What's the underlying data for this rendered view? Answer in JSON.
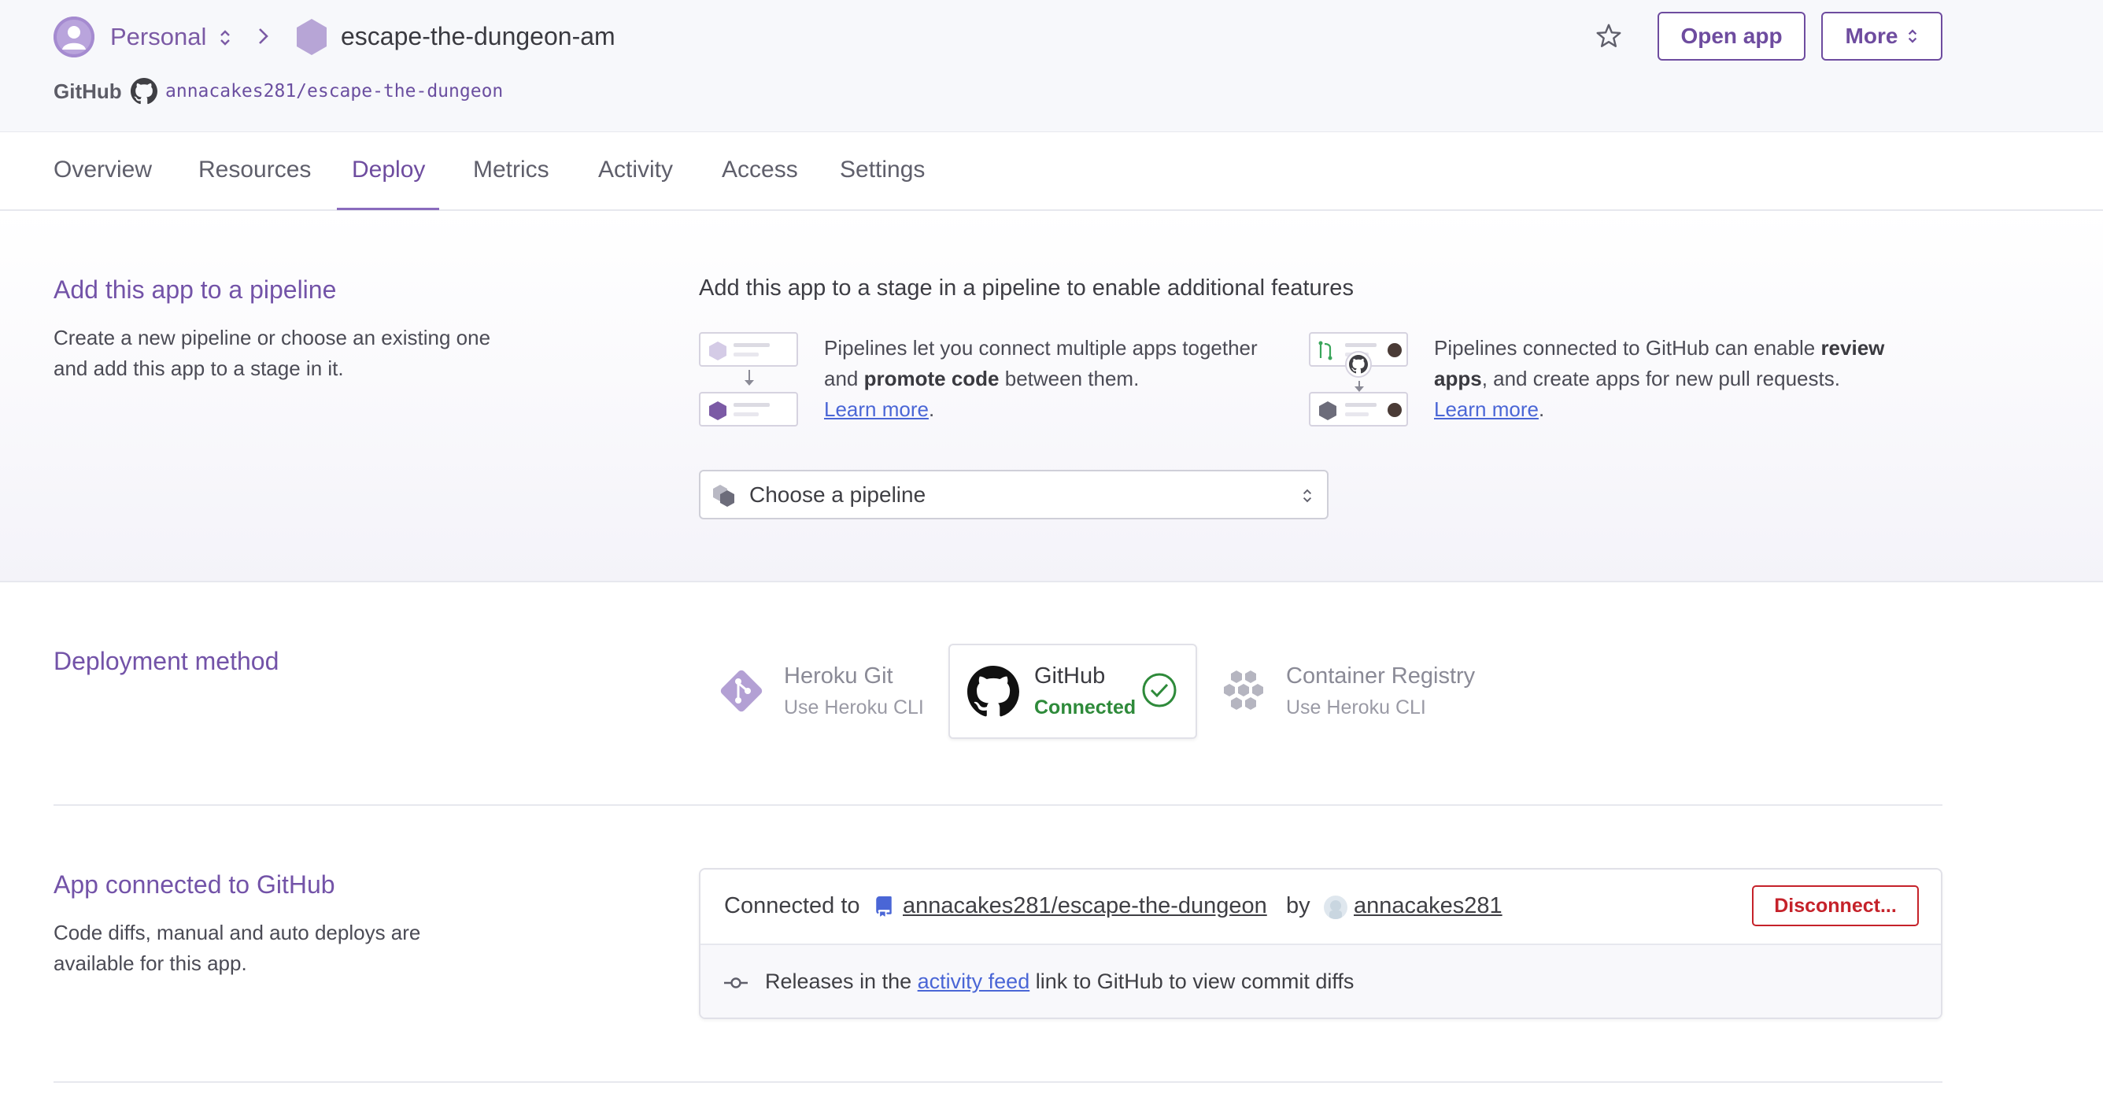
{
  "header": {
    "team": "Personal",
    "app_name": "escape-the-dungeon-am",
    "github_label": "GitHub",
    "repo_path": "annacakes281/escape-the-dungeon",
    "open_app": "Open app",
    "more": "More"
  },
  "tabs": [
    "Overview",
    "Resources",
    "Deploy",
    "Metrics",
    "Activity",
    "Access",
    "Settings"
  ],
  "active_tab": "Deploy",
  "pipeline": {
    "title": "Add this app to a pipeline",
    "description": "Create a new pipeline or choose an existing one and add this app to a stage in it.",
    "lead": "Add this app to a stage in a pipeline to enable additional features",
    "feature1": {
      "pre": "Pipelines let you connect multiple apps together and ",
      "bold": "promote code",
      "post": " between them.",
      "link": "Learn more",
      "tail": "."
    },
    "feature2": {
      "pre": "Pipelines connected to GitHub can enable ",
      "bold": "review apps",
      "post": ", and create apps for new pull requests.",
      "link": "Learn more",
      "tail": "."
    },
    "select_placeholder": "Choose a pipeline"
  },
  "deploy_method": {
    "title": "Deployment method",
    "options": [
      {
        "name": "Heroku Git",
        "sub": "Use Heroku CLI"
      },
      {
        "name": "GitHub",
        "sub": "Connected"
      },
      {
        "name": "Container Registry",
        "sub": "Use Heroku CLI"
      }
    ],
    "selected": "GitHub"
  },
  "connected": {
    "title": "App connected to GitHub",
    "description": "Code diffs, manual and auto deploys are available for this app.",
    "connected_to": "Connected to",
    "repo": "annacakes281/escape-the-dungeon",
    "by": "by",
    "user": "annacakes281",
    "disconnect": "Disconnect...",
    "releases_pre": "Releases in the",
    "activity_feed": "activity feed",
    "releases_post": "link to GitHub to view commit diffs"
  },
  "colors": {
    "brand_purple": "#6e4c9f",
    "link_blue": "#4a66d6",
    "success_green": "#2e8a3a",
    "danger_red": "#c5222a"
  }
}
